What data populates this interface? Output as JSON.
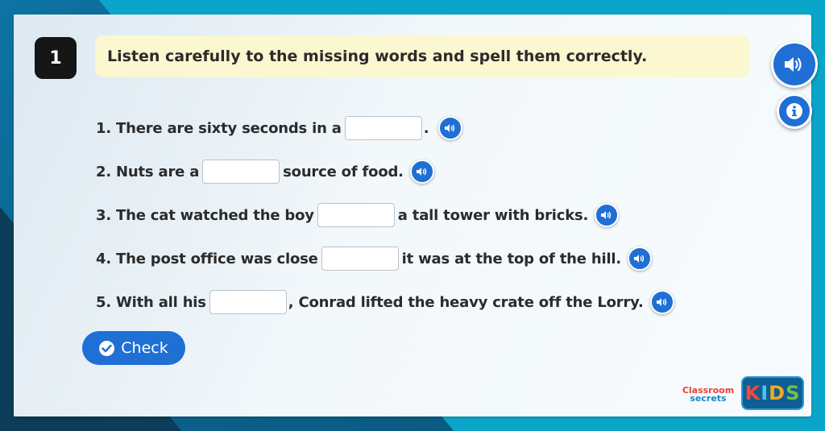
{
  "question_number": "1",
  "instruction": "Listen carefully to the missing words and spell them correctly.",
  "icons": {
    "main_audio": "speaker-icon",
    "info": "info-icon",
    "row_audio": "speaker-icon",
    "check": "checkmark-icon"
  },
  "sentences": [
    {
      "before": "1. There are sixty seconds in a",
      "after": ".",
      "answer": ""
    },
    {
      "before": "2. Nuts are a",
      "after": "source of food.",
      "answer": ""
    },
    {
      "before": "3. The cat watched the boy",
      "after": "a tall tower with bricks.",
      "answer": ""
    },
    {
      "before": "4. The post office was close",
      "after": "it was at the top of the hill.",
      "answer": ""
    },
    {
      "before": "5. With all his",
      "after": ", Conrad lifted the heavy crate off the Lorry.",
      "answer": ""
    }
  ],
  "check_label": "Check",
  "logo": {
    "classroom": "Classroom",
    "secrets": "secrets",
    "kids": "KIDS"
  },
  "colors": {
    "accent": "#1f6fd4",
    "instruction_bg": "#fbf7d1",
    "page_bg": "#0aa6c9"
  }
}
